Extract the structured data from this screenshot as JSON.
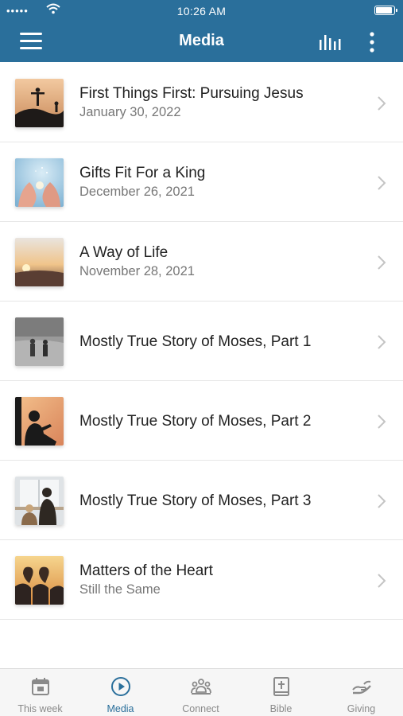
{
  "status_bar": {
    "time": "10:26 AM",
    "signal": "•••••"
  },
  "header": {
    "title": "Media"
  },
  "media_items": [
    {
      "title": "First Things First: Pursuing Jesus",
      "subtitle": "January 30, 2022",
      "thumbnail": "silhouette-sunset"
    },
    {
      "title": "Gifts Fit For a King",
      "subtitle": "December 26, 2021",
      "thumbnail": "hands-light"
    },
    {
      "title": "A Way of Life",
      "subtitle": "November 28, 2021",
      "thumbnail": "sunrise-horizon"
    },
    {
      "title": "Mostly True Story of Moses, Part 1",
      "subtitle": "",
      "thumbnail": "bw-people-walking"
    },
    {
      "title": "Mostly True Story of Moses, Part 2",
      "subtitle": "",
      "thumbnail": "child-reading-silhouette"
    },
    {
      "title": "Mostly True Story of Moses, Part 3",
      "subtitle": "",
      "thumbnail": "kids-at-window"
    },
    {
      "title": "Matters of the Heart",
      "subtitle": "Still the Same",
      "thumbnail": "hands-heart"
    }
  ],
  "tabs": [
    {
      "label": "This week",
      "icon": "calendar-icon",
      "active": false
    },
    {
      "label": "Media",
      "icon": "play-circle-icon",
      "active": true
    },
    {
      "label": "Connect",
      "icon": "people-icon",
      "active": false
    },
    {
      "label": "Bible",
      "icon": "bible-icon",
      "active": false
    },
    {
      "label": "Giving",
      "icon": "giving-hand-icon",
      "active": false
    }
  ],
  "colors": {
    "header_bg": "#2a6f9b",
    "accent": "#2a6f9b",
    "tab_inactive": "#8a8a8a"
  }
}
